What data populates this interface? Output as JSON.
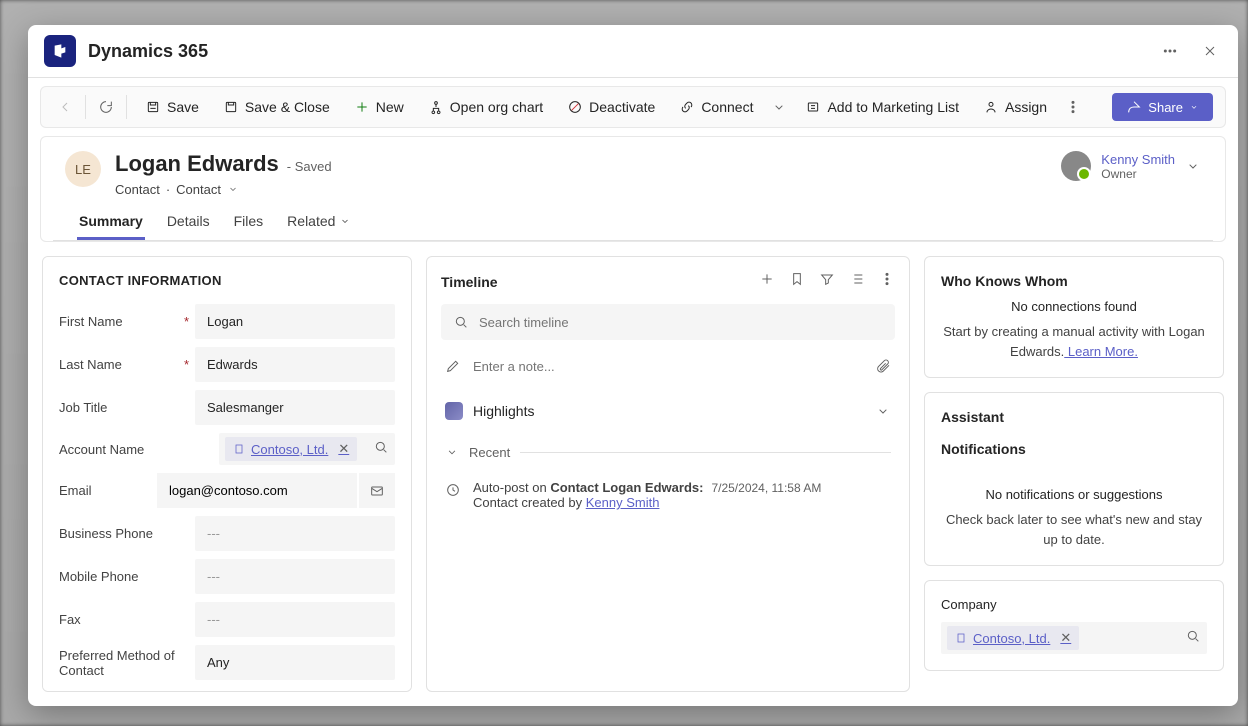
{
  "app": {
    "title": "Dynamics 365"
  },
  "toolbar": {
    "save": "Save",
    "saveClose": "Save & Close",
    "new": "New",
    "openOrgChart": "Open org chart",
    "deactivate": "Deactivate",
    "connect": "Connect",
    "addToMarketing": "Add to Marketing List",
    "assign": "Assign",
    "share": "Share"
  },
  "record": {
    "avatar": "LE",
    "name": "Logan Edwards",
    "savedState": "- Saved",
    "entity1": "Contact",
    "entity2": "Contact",
    "owner": {
      "name": "Kenny Smith",
      "role": "Owner"
    }
  },
  "tabs": {
    "summary": "Summary",
    "details": "Details",
    "files": "Files",
    "related": "Related"
  },
  "contact": {
    "sectionTitle": "CONTACT INFORMATION",
    "labels": {
      "firstName": "First Name",
      "lastName": "Last Name",
      "jobTitle": "Job Title",
      "accountName": "Account Name",
      "email": "Email",
      "businessPhone": "Business Phone",
      "mobilePhone": "Mobile Phone",
      "fax": "Fax",
      "preferredMethod": "Preferred Method of Contact"
    },
    "values": {
      "firstName": "Logan",
      "lastName": "Edwards",
      "jobTitle": "Salesmanger",
      "accountName": "Contoso, Ltd.",
      "email": "logan@contoso.com",
      "businessPhone": "---",
      "mobilePhone": "---",
      "fax": "---",
      "preferredMethod": "Any"
    }
  },
  "timeline": {
    "title": "Timeline",
    "searchPlaceholder": "Search timeline",
    "notePlaceholder": "Enter a note...",
    "highlights": "Highlights",
    "recent": "Recent",
    "post": {
      "prefix": "Auto-post on ",
      "subject": "Contact Logan Edwards:",
      "time": "7/25/2024, 11:58 AM",
      "line2prefix": "Contact created by ",
      "author": "Kenny Smith"
    }
  },
  "whoKnows": {
    "title": "Who Knows Whom",
    "empty": "No connections found",
    "hint1": "Start by creating a manual activity with Logan Edwards.",
    "learnMore": " Learn More."
  },
  "assistant": {
    "title": "Assistant"
  },
  "notifications": {
    "title": "Notifications",
    "empty": "No notifications or suggestions",
    "hint": "Check back later to see what's new and stay up to date."
  },
  "company": {
    "title": "Company",
    "value": "Contoso, Ltd."
  }
}
